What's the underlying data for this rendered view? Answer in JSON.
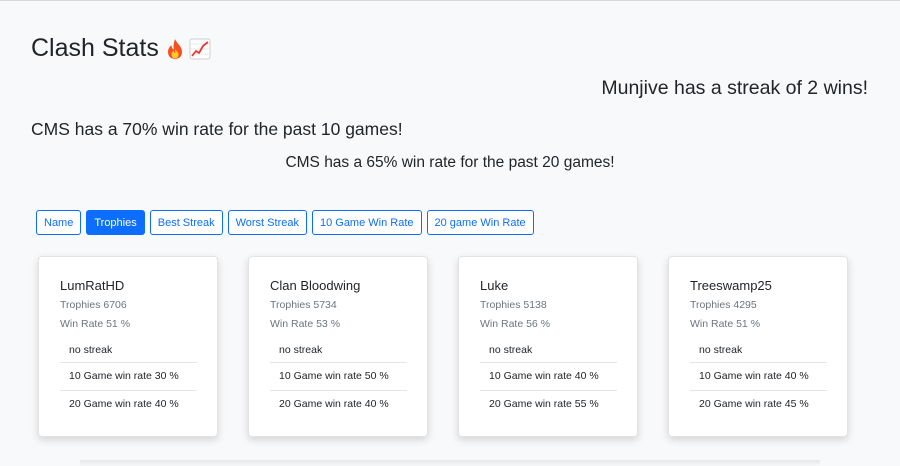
{
  "header": {
    "title": "Clash Stats",
    "title_icons": [
      "fire-icon",
      "chart-increasing-icon"
    ]
  },
  "messages": {
    "streak": "Munjive has a streak of 2 wins!",
    "rate10": "CMS has a 70% win rate for the past 10 games!",
    "rate20": "CMS has a 65% win rate for the past 20 games!"
  },
  "sort_buttons": [
    {
      "label": "Name",
      "active": false
    },
    {
      "label": "Trophies",
      "active": true
    },
    {
      "label": "Best Streak",
      "active": false
    },
    {
      "label": "Worst Streak",
      "active": false
    },
    {
      "label": "10 Game Win Rate",
      "active": false
    },
    {
      "label": "20 game Win Rate",
      "active": false
    }
  ],
  "players": [
    {
      "name": "LumRatHD",
      "trophies": "Trophies 6706",
      "win_rate": "Win Rate 51 %",
      "streak": "no streak",
      "rate10": "10 Game win rate 30 %",
      "rate20": "20 Game win rate 40 %"
    },
    {
      "name": "Clan Bloodwing",
      "trophies": "Trophies 5734",
      "win_rate": "Win Rate 53 %",
      "streak": "no streak",
      "rate10": "10 Game win rate 50 %",
      "rate20": "20 Game win rate 40 %"
    },
    {
      "name": "Luke",
      "trophies": "Trophies 5138",
      "win_rate": "Win Rate 56 %",
      "streak": "no streak",
      "rate10": "10 Game win rate 40 %",
      "rate20": "20 Game win rate 55 %"
    },
    {
      "name": "Treeswamp25",
      "trophies": "Trophies 4295",
      "win_rate": "Win Rate 51 %",
      "streak": "no streak",
      "rate10": "10 Game win rate 40 %",
      "rate20": "20 Game win rate 45 %"
    }
  ],
  "colors": {
    "accent": "#0d6efd",
    "background": "#f8f9fa",
    "muted_text": "#6c757d"
  }
}
